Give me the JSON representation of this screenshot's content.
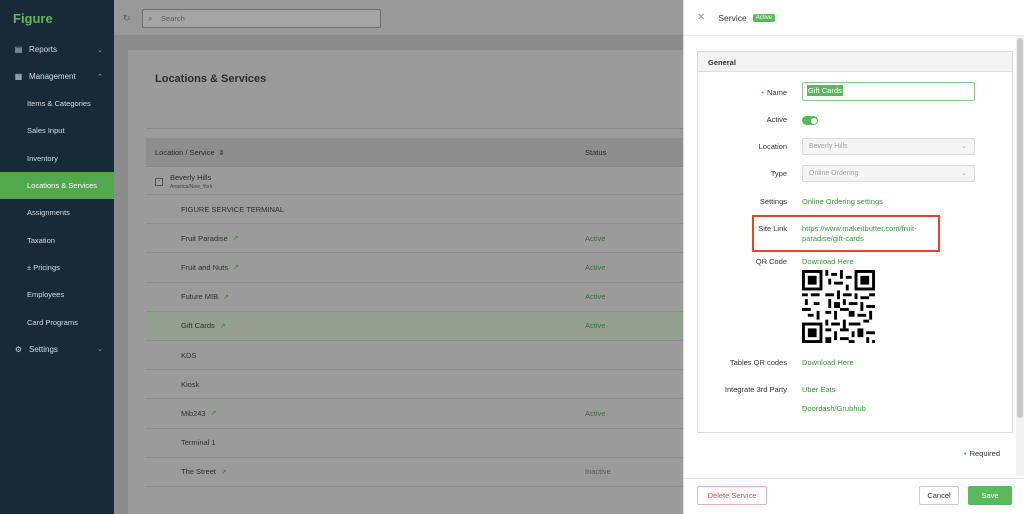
{
  "app": {
    "brand": "Figure"
  },
  "sidebar": {
    "reports": "Reports",
    "management": "Management",
    "items": [
      {
        "label": "Items & Categories"
      },
      {
        "label": "Sales Input"
      },
      {
        "label": "Inventory"
      },
      {
        "label": "Locations & Services"
      },
      {
        "label": "Assignments"
      },
      {
        "label": "Taxation"
      },
      {
        "label": "± Pricings"
      },
      {
        "label": "Employees"
      },
      {
        "label": "Card Programs"
      }
    ],
    "settings": "Settings",
    "active_item": "Locations & Services"
  },
  "topbar": {
    "search_placeholder": "Search"
  },
  "main": {
    "title": "Locations & Services",
    "columns": {
      "location": "Location / Service",
      "status": "Status"
    },
    "group": {
      "name": "Beverly Hills",
      "timezone": "America/New_York"
    },
    "rows": [
      {
        "name": "FIGURE SERVICE TERMINAL",
        "status": "",
        "link": false,
        "indent": "service"
      },
      {
        "name": "Fruit Paradise",
        "status": "Active",
        "link": true
      },
      {
        "name": "Fruit and Nuts",
        "status": "Active",
        "link": true
      },
      {
        "name": "Future MIB",
        "status": "Active",
        "link": true
      },
      {
        "name": "Gift Cards",
        "status": "Active",
        "link": true,
        "selected": true
      },
      {
        "name": "KDS",
        "status": "",
        "link": false
      },
      {
        "name": "Kiosk",
        "status": "",
        "link": false
      },
      {
        "name": "Mib243",
        "status": "Active",
        "link": true
      },
      {
        "name": "Terminal 1",
        "status": "",
        "link": false
      },
      {
        "name": "The Street",
        "status": "Inactive",
        "link": true
      }
    ]
  },
  "panel": {
    "title": "Service",
    "badge": "Active",
    "section": "General",
    "labels": {
      "name": "Name",
      "active": "Active",
      "location": "Location",
      "type": "Type",
      "settings": "Settings",
      "site_link": "Site Link",
      "qr_code": "QR Code",
      "tables_qr": "Tables QR codes",
      "integrate": "Integrate 3rd Party"
    },
    "values": {
      "name": "Gift Cards",
      "active": true,
      "location": "Beverly Hills",
      "type": "Online Ordering",
      "settings_link": "Online Ordering settings",
      "site_link_line1": "https://www.makeitbutter.com/fruit-",
      "site_link_line2": "paradise/gift-cards",
      "qr_download": "Download Here",
      "tables_qr_download": "Download Here",
      "integrations": [
        "Uber Eats",
        "Doordash/Grubhub"
      ]
    },
    "required_note": "Required",
    "buttons": {
      "delete": "Delete Service",
      "cancel": "Cancel",
      "save": "Save"
    }
  },
  "colors": {
    "accent": "#5cb85c",
    "sidebar": "#182a38",
    "highlight_box": "#e0452f"
  }
}
